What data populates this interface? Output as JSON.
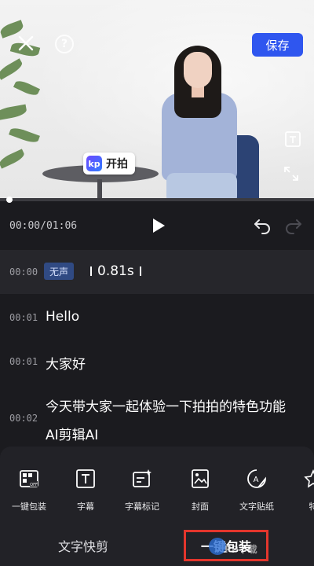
{
  "preview": {
    "save_label": "保存",
    "help_glyph": "?",
    "logo_mark": "kp",
    "logo_text": "开拍"
  },
  "playback": {
    "time": "00:00/01:06"
  },
  "subtitles": {
    "silent_row": {
      "time": "00:00",
      "badge": "无声",
      "duration": "0.81s"
    },
    "rows": [
      {
        "time": "00:01",
        "text": "Hello"
      },
      {
        "time": "00:01",
        "text": "大家好"
      },
      {
        "time": "00:02",
        "line1": "今天带大家一起体验一下拍拍的特色功能",
        "line2": "AI剪辑AI"
      }
    ]
  },
  "toolbar": {
    "tools": [
      {
        "label": "一键包装",
        "icon": "auto-package-icon"
      },
      {
        "label": "字幕",
        "icon": "subtitle-icon"
      },
      {
        "label": "字幕标记",
        "icon": "subtitle-mark-icon"
      },
      {
        "label": "封面",
        "icon": "cover-icon"
      },
      {
        "label": "文字贴纸",
        "icon": "text-sticker-icon"
      },
      {
        "label": "特",
        "icon": "effects-icon"
      }
    ]
  },
  "tabs": {
    "left": "文字快剪",
    "right": "一键包装"
  },
  "watermark": "PP下载",
  "colors": {
    "accent": "#2f56ef",
    "highlight": "#e4362d",
    "background": "#1b1b1f"
  }
}
